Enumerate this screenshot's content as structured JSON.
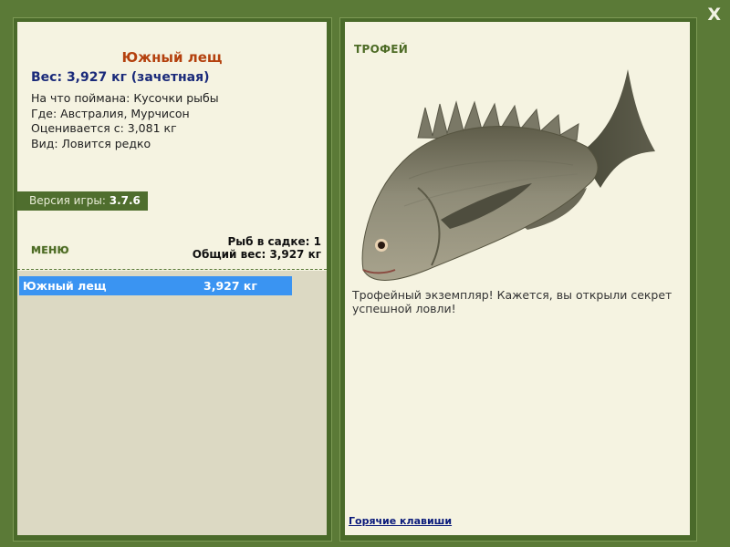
{
  "window": {
    "close_label": "X"
  },
  "fish": {
    "name": "Южный лещ",
    "weight_line": "Вес: 3,927 кг (зачетная)",
    "caught_on": "На что поймана: Кусочки рыбы",
    "location": "Где: Австралия, Мурчисон",
    "valued_from": "Оценивается с: 3,081 кг",
    "rarity": "Вид: Ловится редко"
  },
  "version": {
    "label": "Версия игры:",
    "value": "3.7.6"
  },
  "menu_label": "МЕНЮ",
  "keep": {
    "fish_count": "Рыб в садке: 1",
    "total_weight": "Общий вес: 3,927 кг",
    "items": [
      {
        "name": "Южный лещ",
        "weight": "3,927 кг"
      }
    ]
  },
  "trophy": {
    "label": "ТРОФЕЙ",
    "message": "Трофейный экземпляр! Кажется, вы открыли секрет успешной ловли!",
    "hotkeys_link": "Горячие клавиши"
  },
  "colors": {
    "frame_green": "#5b7a37",
    "panel_cream": "#f5f3e1",
    "list_beige": "#dcd9c3",
    "fish_name_orange": "#b4410e",
    "weight_navy": "#1a2a7a",
    "selection_blue": "#3a94f2"
  }
}
